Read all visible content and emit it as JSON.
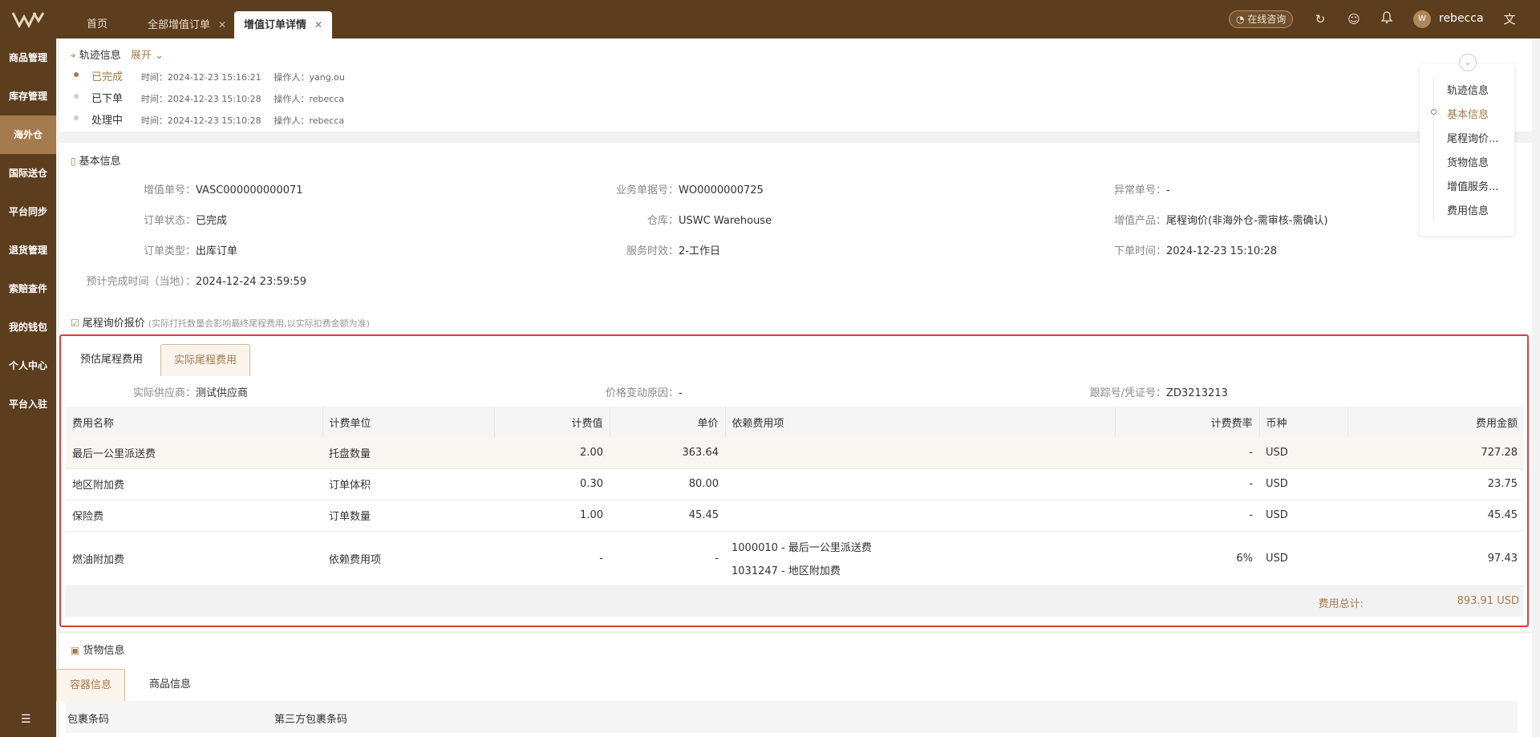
{
  "header": {
    "tabs": [
      {
        "label": "首页",
        "closable": false,
        "active": false
      },
      {
        "label": "全部增值订单",
        "closable": true,
        "active": false
      },
      {
        "label": "增值订单详情",
        "closable": true,
        "active": true
      }
    ],
    "consult_label": "在线咨询",
    "username": "rebecca",
    "icons": [
      "refresh-icon",
      "feedback-icon",
      "bell-icon",
      "translate-icon"
    ]
  },
  "sidebar": {
    "items": [
      {
        "label": "商品管理"
      },
      {
        "label": "库存管理"
      },
      {
        "label": "海外仓",
        "active": true
      },
      {
        "label": "国际送仓"
      },
      {
        "label": "平台同步"
      },
      {
        "label": "退货管理"
      },
      {
        "label": "索赔查件"
      },
      {
        "label": "我的钱包"
      },
      {
        "label": "个人中心"
      },
      {
        "label": "平台入驻"
      }
    ]
  },
  "track": {
    "title": "轨迹信息",
    "expand_label": "展开",
    "rows": [
      {
        "status": "已完成",
        "time": "时间：2024-12-23 15:16:21",
        "operator": "操作人：yang.ou"
      },
      {
        "status": "已下单",
        "time": "时间：2024-12-23 15:10:28",
        "operator": "操作人：rebecca"
      },
      {
        "status": "处理中",
        "time": "时间：2024-12-23 15:10:28",
        "operator": "操作人：rebecca"
      }
    ]
  },
  "basic": {
    "title": "基本信息",
    "fields": {
      "vas_no_k": "增值单号：",
      "vas_no_v": "VASC000000000071",
      "biz_no_k": "业务单据号：",
      "biz_no_v": "WO0000000725",
      "exc_no_k": "异常单号：",
      "exc_no_v": "-",
      "status_k": "订单状态：",
      "status_v": "已完成",
      "wh_k": "仓库：",
      "wh_v": "USWC Warehouse",
      "product_k": "增值产品：",
      "product_v": "尾程询价(非海外仓-需审核-需确认)",
      "type_k": "订单类型：",
      "type_v": "出库订单",
      "sla_k": "服务时效：",
      "sla_v": "2-工作日",
      "ordered_k": "下单时间：",
      "ordered_v": "2024-12-23 15:10:28",
      "eta_k": "预计完成时间（当地）：",
      "eta_v": "2024-12-24 23:59:59"
    }
  },
  "quote": {
    "title": "尾程询价报价",
    "hint": "(实际打托数量会影响最终尾程费用,以实际扣费金额为准)",
    "tabs": [
      "预估尾程费用",
      "实际尾程费用"
    ],
    "active_tab": 1,
    "supplier_k": "实际供应商：",
    "supplier_v": "测试供应商",
    "reason_k": "价格变动原因：",
    "reason_v": "-",
    "track_k": "跟踪号/凭证号：",
    "track_v": "ZD3213213",
    "columns": [
      "费用名称",
      "计费单位",
      "计费值",
      "单价",
      "依赖费用项",
      "计费费率",
      "币种",
      "费用金额"
    ],
    "rows": [
      {
        "name": "最后一公里派送费",
        "unit": "托盘数量",
        "qty": "2.00",
        "price": "363.64",
        "dep1": "",
        "dep2": "",
        "rate": "-",
        "currency": "USD",
        "amount": "727.28"
      },
      {
        "name": "地区附加费",
        "unit": "订单体积",
        "qty": "0.30",
        "price": "80.00",
        "dep1": "",
        "dep2": "",
        "rate": "-",
        "currency": "USD",
        "amount": "23.75"
      },
      {
        "name": "保险费",
        "unit": "订单数量",
        "qty": "1.00",
        "price": "45.45",
        "dep1": "",
        "dep2": "",
        "rate": "-",
        "currency": "USD",
        "amount": "45.45"
      },
      {
        "name": "燃油附加费",
        "unit": "依赖费用项",
        "qty": "-",
        "price": "-",
        "dep1": "1000010 - 最后一公里派送费",
        "dep2": "1031247 - 地区附加费",
        "rate": "6%",
        "currency": "USD",
        "amount": "97.43"
      }
    ],
    "total_label": "费用总计:",
    "total_value": "893.91 USD"
  },
  "cargo": {
    "title": "货物信息",
    "tabs": [
      "容器信息",
      "商品信息"
    ],
    "columns": [
      "包裹条码",
      "第三方包裹条码"
    ]
  },
  "anchor_nav": {
    "items": [
      "轨迹信息",
      "基本信息",
      "尾程询价...",
      "货物信息",
      "增值服务...",
      "费用信息"
    ],
    "active_index": 1
  },
  "colors": {
    "brand": "#5c3d1e",
    "accent": "#a57a4c",
    "highlight_border": "#e03c3c"
  }
}
